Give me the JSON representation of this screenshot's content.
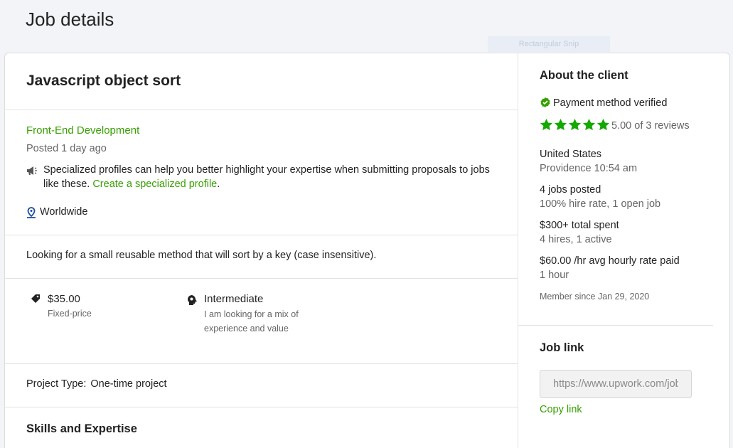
{
  "page": {
    "title": "Job details",
    "overlay_label": "Rectangular Snip"
  },
  "job": {
    "title": "Javascript object sort",
    "category": "Front-End Development",
    "posted": "Posted 1 day ago",
    "promo_text": "Specialized profiles can help you better highlight your expertise when submitting proposals to jobs like these. ",
    "promo_link": "Create a specialized profile",
    "promo_end": ".",
    "location": "Worldwide",
    "description": "Looking for a small reusable method that will sort by a key (case insensitive).",
    "price": "$35.00",
    "price_type": "Fixed-price",
    "level": "Intermediate",
    "level_desc": "I am looking for a mix of experience and value",
    "project_type_label": "Project Type:",
    "project_type_value": "One-time project",
    "skills_heading": "Skills and Expertise"
  },
  "client": {
    "heading": "About the client",
    "payment": "Payment method verified",
    "rating_value": 5.0,
    "rating_text": "5.00 of 3 reviews",
    "country": "United States",
    "city_time": "Providence 10:54 am",
    "jobs_posted": "4 jobs posted",
    "hire_rate": "100% hire rate, 1 open job",
    "total_spent": "$300+ total spent",
    "hires": "4 hires, 1 active",
    "avg_rate": "$60.00 /hr avg hourly rate paid",
    "hours": "1 hour",
    "member_since": "Member since Jan 29, 2020"
  },
  "job_link": {
    "heading": "Job link",
    "url": "https://www.upwork.com/jobs/",
    "copy_label": "Copy link"
  },
  "colors": {
    "accent": "#37a000",
    "verified": "#37a000",
    "location_icon": "#1d4fa0"
  },
  "icons": [
    "megaphone-icon",
    "location-pin-icon",
    "price-tag-icon",
    "brain-head-icon",
    "verified-check-icon",
    "star-icon"
  ]
}
